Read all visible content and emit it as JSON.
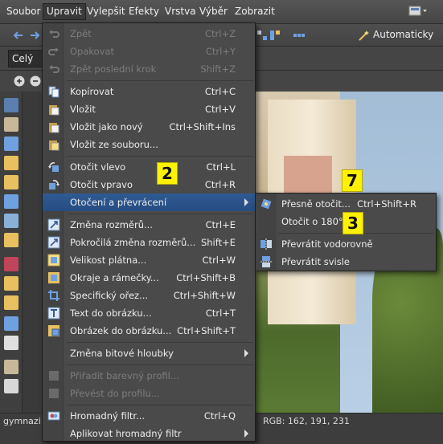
{
  "menubar": {
    "items": [
      {
        "label": "Soubor"
      },
      {
        "label": "Upravit"
      },
      {
        "label": "Vylepšit"
      },
      {
        "label": "Efekty"
      },
      {
        "label": "Vrstva"
      },
      {
        "label": "Výběr"
      },
      {
        "label": "Zobrazit"
      }
    ]
  },
  "toolbar": {
    "auto_label": "Automaticky",
    "zoom_combo": "Celý"
  },
  "edit_menu": {
    "items": [
      {
        "label": "Zpět",
        "shortcut": "Ctrl+Z",
        "disabled": true,
        "icon": "undo-icon"
      },
      {
        "label": "Opakovat",
        "shortcut": "Ctrl+Y",
        "disabled": true,
        "icon": "redo-icon"
      },
      {
        "label": "Zpět poslední krok",
        "shortcut": "Shift+Z",
        "disabled": true,
        "icon": "undo-last-icon"
      },
      {
        "label": "Kopírovat",
        "shortcut": "Ctrl+C",
        "icon": "copy-icon"
      },
      {
        "label": "Vložit",
        "shortcut": "Ctrl+V",
        "icon": "paste-icon"
      },
      {
        "label": "Vložit jako nový",
        "shortcut": "Ctrl+Shift+Ins",
        "icon": "paste-new-icon"
      },
      {
        "label": "Vložit ze souboru...",
        "shortcut": "",
        "icon": "paste-file-icon"
      },
      {
        "label": "Otočit vlevo",
        "shortcut": "Ctrl+L",
        "icon": "rotate-left-icon"
      },
      {
        "label": "Otočit vpravo",
        "shortcut": "Ctrl+R",
        "icon": "rotate-right-icon"
      },
      {
        "label": "Otočení a převrácení",
        "shortcut": "",
        "submenu": true
      },
      {
        "label": "Změna rozměrů...",
        "shortcut": "Ctrl+E",
        "icon": "resize-icon"
      },
      {
        "label": "Pokročilá změna rozměrů...",
        "shortcut": "Shift+E",
        "icon": "advanced-resize-icon"
      },
      {
        "label": "Velikost plátna...",
        "shortcut": "Ctrl+W",
        "icon": "canvas-size-icon"
      },
      {
        "label": "Okraje a rámečky...",
        "shortcut": "Ctrl+Shift+B",
        "icon": "borders-icon"
      },
      {
        "label": "Specifický ořez...",
        "shortcut": "Ctrl+Shift+W",
        "icon": "crop-icon"
      },
      {
        "label": "Text do obrázku...",
        "shortcut": "Ctrl+T",
        "icon": "text-icon"
      },
      {
        "label": "Obrázek do obrázku...",
        "shortcut": "Ctrl+Shift+T",
        "icon": "image-in-image-icon"
      },
      {
        "label": "Změna bitové hloubky",
        "shortcut": "",
        "submenu": true
      },
      {
        "label": "Přiřadit barevný profil...",
        "shortcut": "",
        "disabled": true,
        "icon": "color-profile-icon"
      },
      {
        "label": "Převést do profilu...",
        "shortcut": "",
        "disabled": true,
        "icon": "convert-profile-icon"
      },
      {
        "label": "Hromadný filtr...",
        "shortcut": "Ctrl+Q",
        "icon": "batch-filter-icon"
      },
      {
        "label": "Aplikovat hromadný filtr",
        "shortcut": "",
        "submenu": true
      }
    ]
  },
  "rotate_submenu": {
    "items": [
      {
        "label": "Přesně otočit...",
        "shortcut": "Ctrl+Shift+R",
        "icon": "precise-rotate-icon"
      },
      {
        "label": "Otočit o 180°",
        "shortcut": ""
      },
      {
        "label": "Převrátit vodorovně",
        "shortcut": "",
        "icon": "flip-horizontal-icon"
      },
      {
        "label": "Převrátit svisle",
        "shortcut": "",
        "icon": "flip-vertical-icon"
      }
    ]
  },
  "badges": [
    "2",
    "7",
    "3"
  ],
  "status": {
    "filename": "gymnazi",
    "rgb": "RGB: 162, 191, 231"
  },
  "colors": {
    "highlight": "#2f5a93",
    "badge": "#fff200"
  }
}
